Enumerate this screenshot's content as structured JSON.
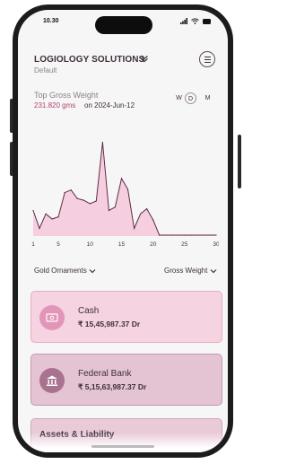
{
  "status_bar": {
    "time": "10.30"
  },
  "header": {
    "title": "LOGIOLOGY SOLUTIONS",
    "subtitle": "Default"
  },
  "kpi": {
    "title": "Top Gross Weight",
    "value": "231.820 gms",
    "date_text": "on 2024-Jun-12"
  },
  "period_toggle": {
    "options": [
      "W",
      "D",
      "M"
    ],
    "selected": "D"
  },
  "chart_data": {
    "type": "area",
    "x": [
      1,
      2,
      3,
      4,
      5,
      6,
      7,
      8,
      9,
      10,
      11,
      12,
      13,
      14,
      15,
      16,
      17,
      18,
      19,
      20,
      21,
      22,
      23,
      24,
      25,
      26,
      27,
      28,
      29,
      30
    ],
    "values": [
      60,
      18,
      52,
      40,
      45,
      102,
      108,
      88,
      84,
      76,
      82,
      220,
      60,
      68,
      135,
      110,
      18,
      52,
      64,
      38,
      2,
      2,
      2,
      2,
      2,
      2,
      2,
      2,
      2,
      2
    ],
    "x_ticks": [
      "1",
      "5",
      "10",
      "15",
      "20",
      "25",
      "30"
    ],
    "x_tick_values": [
      1,
      5,
      10,
      15,
      20,
      25,
      30
    ],
    "ylim": [
      0,
      240
    ],
    "xlim": [
      1,
      30
    ],
    "line_color": "#5e2a45",
    "fill_color": "#f5cfe0",
    "grid": false
  },
  "filters": {
    "left": "Gold Ornaments",
    "right": "Gross Weight"
  },
  "cards": [
    {
      "name": "Cash",
      "amount": "₹ 15,45,987.37 Dr",
      "icon": "cash-icon",
      "bg": "#f6d3e1",
      "border": "#e3adc5",
      "icon_bg": "#e295b8"
    },
    {
      "name": "Federal Bank",
      "amount": "₹ 5,15,63,987.37 Dr",
      "icon": "bank-icon",
      "bg": "#e4c3d2",
      "border": "#c49aaf",
      "icon_bg": "#a9728f"
    },
    {
      "name": "Assets & Liability",
      "bg": "#e9cbd8",
      "border": "#cda7b8"
    }
  ]
}
